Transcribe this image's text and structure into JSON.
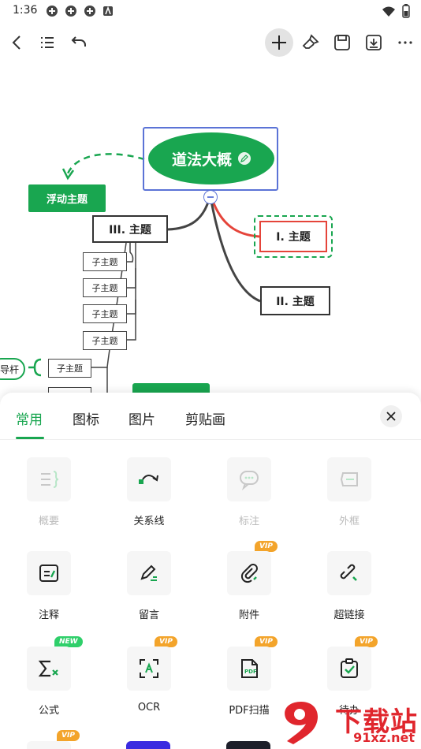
{
  "status": {
    "time": "1:36"
  },
  "mindmap": {
    "root": "道法大概",
    "floating": "浮动主题",
    "topic3": "III. 主题",
    "topic1": "I. 主题",
    "topic2": "II. 主题",
    "subtopics": [
      "子主题",
      "子主题",
      "子主题",
      "子主题",
      "子主题"
    ],
    "guide": "导杆"
  },
  "sheet": {
    "tabs": [
      "常用",
      "图标",
      "图片",
      "剪贴画"
    ],
    "items": [
      {
        "label": "概要",
        "icon": "summary-icon",
        "disabled": true
      },
      {
        "label": "关系线",
        "icon": "relation-line-icon",
        "disabled": false
      },
      {
        "label": "标注",
        "icon": "callout-icon",
        "disabled": true
      },
      {
        "label": "外框",
        "icon": "boundary-icon",
        "disabled": true
      },
      {
        "label": "注释",
        "icon": "note-icon",
        "disabled": false
      },
      {
        "label": "留言",
        "icon": "comment-icon",
        "disabled": false
      },
      {
        "label": "附件",
        "icon": "attachment-icon",
        "disabled": false,
        "badge": "VIP"
      },
      {
        "label": "超链接",
        "icon": "hyperlink-icon",
        "disabled": false
      },
      {
        "label": "公式",
        "icon": "formula-icon",
        "disabled": false,
        "badge": "NEW"
      },
      {
        "label": "OCR",
        "icon": "ocr-icon",
        "disabled": false,
        "badge": "VIP"
      },
      {
        "label": "PDF扫描",
        "icon": "pdf-scan-icon",
        "disabled": false,
        "badge": "VIP"
      },
      {
        "label": "待办",
        "icon": "todo-icon",
        "disabled": false,
        "badge": "VIP"
      }
    ],
    "partial_badge": "VIP"
  },
  "watermark": {
    "brand": "下载站",
    "url": "91xz.net",
    "logo": "9"
  },
  "colors": {
    "accent": "#19a650",
    "selection": "#5b73d6",
    "highlight": "#e5443a",
    "vip": "#f3a42b",
    "new": "#2fcf6a"
  }
}
